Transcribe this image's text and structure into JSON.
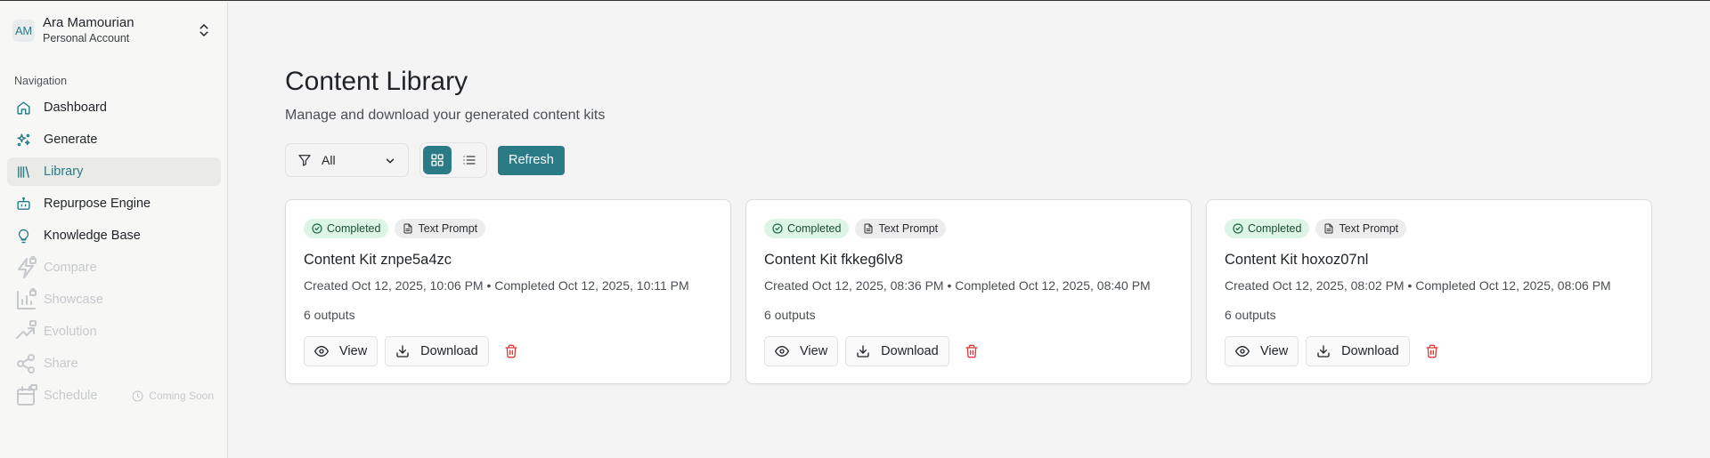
{
  "account": {
    "initials": "AM",
    "name": "Ara Mamourian",
    "type": "Personal Account"
  },
  "nav": {
    "heading": "Navigation",
    "items": [
      {
        "label": "Dashboard",
        "icon": "home-icon"
      },
      {
        "label": "Generate",
        "icon": "sparkles-icon"
      },
      {
        "label": "Library",
        "icon": "library-icon",
        "active": true
      },
      {
        "label": "Repurpose Engine",
        "icon": "bot-icon"
      },
      {
        "label": "Knowledge Base",
        "icon": "lightbulb-icon"
      },
      {
        "label": "Compare",
        "icon": "zap-locked-icon",
        "disabled": true
      },
      {
        "label": "Showcase",
        "icon": "chart-locked-icon",
        "disabled": true
      },
      {
        "label": "Evolution",
        "icon": "trend-locked-icon",
        "disabled": true
      },
      {
        "label": "Share",
        "icon": "share-locked-icon",
        "disabled": true
      },
      {
        "label": "Schedule",
        "icon": "calendar-locked-icon",
        "disabled": true,
        "note": "Coming Soon"
      }
    ]
  },
  "page": {
    "title": "Content Library",
    "subtitle": "Manage and download your generated content kits"
  },
  "toolbar": {
    "filter_value": "All",
    "view_mode": "grid",
    "refresh_label": "Refresh"
  },
  "cards": [
    {
      "status": "Completed",
      "type": "Text Prompt",
      "title": "Content Kit znpe5a4zc",
      "meta": "Created Oct 12, 2025, 10:06 PM • Completed Oct 12, 2025, 10:11 PM",
      "outputs": "6 outputs",
      "view_label": "View",
      "download_label": "Download"
    },
    {
      "status": "Completed",
      "type": "Text Prompt",
      "title": "Content Kit fkkeg6lv8",
      "meta": "Created Oct 12, 2025, 08:36 PM • Completed Oct 12, 2025, 08:40 PM",
      "outputs": "6 outputs",
      "view_label": "View",
      "download_label": "Download"
    },
    {
      "status": "Completed",
      "type": "Text Prompt",
      "title": "Content Kit hoxoz07nl",
      "meta": "Created Oct 12, 2025, 08:02 PM • Completed Oct 12, 2025, 08:06 PM",
      "outputs": "6 outputs",
      "view_label": "View",
      "download_label": "Download"
    }
  ],
  "colors": {
    "accent": "#2b7b87",
    "completed_bg": "#dcf5e6",
    "delete": "#d93a3a"
  }
}
